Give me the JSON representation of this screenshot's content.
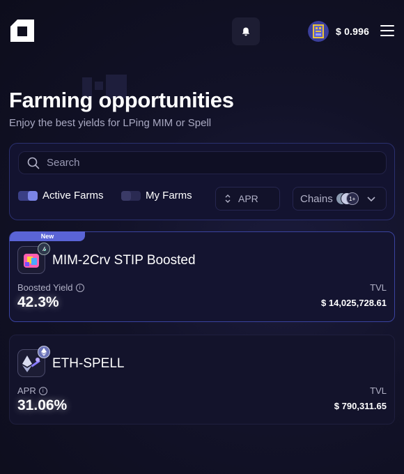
{
  "header": {
    "price": "$ 0.996",
    "icons": [
      "logo-icon",
      "bell-icon",
      "spell-token-icon",
      "menu-icon"
    ]
  },
  "page": {
    "title": "Farming opportunities",
    "subtitle": "Enjoy the best yields for LPing MIM or Spell"
  },
  "filters": {
    "search_placeholder": "Search",
    "active_farms_label": "Active Farms",
    "active_farms_on": true,
    "my_farms_label": "My Farms",
    "my_farms_on": false,
    "sort_label": "APR",
    "chains_label": "Chains",
    "chains_more": "1+"
  },
  "farms": [
    {
      "badge": "New",
      "name": "MIM-2Crv STIP Boosted",
      "metric_label": "Boosted Yield",
      "metric_value": "42.3%",
      "tvl_label": "TVL",
      "tvl_value": "$ 14,025,728.61"
    },
    {
      "name": "ETH-SPELL",
      "metric_label": "APR",
      "metric_value": "31.06%",
      "tvl_label": "TVL",
      "tvl_value": "$ 790,311.65"
    }
  ],
  "colors": {
    "accent": "#5a64d6",
    "toggle_on": "#7a84e6",
    "toggle_off": "#3a3a66",
    "background": "#121228"
  }
}
